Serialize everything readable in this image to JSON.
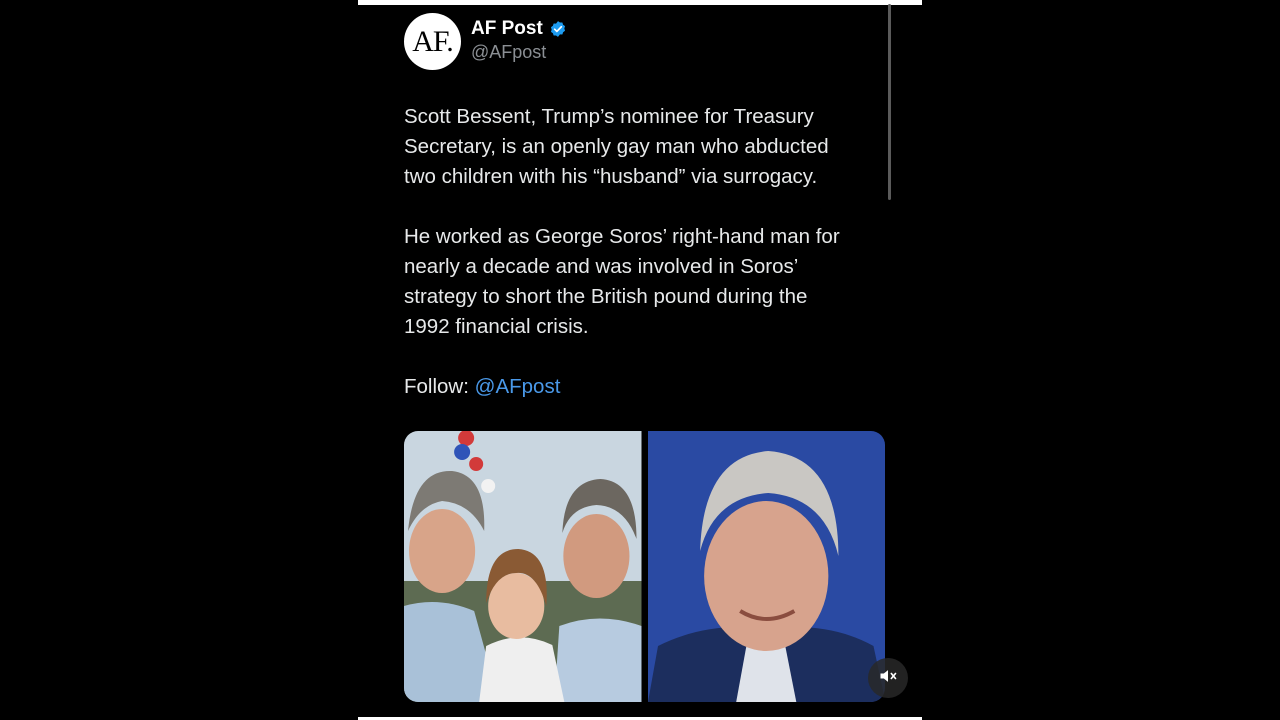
{
  "author": {
    "avatar_text": "AF.",
    "display_name": "AF Post",
    "handle": "@AFpost",
    "verified_icon": "verified-badge-icon"
  },
  "post": {
    "paragraph_1": "Scott Bessent, Trump’s nominee for Treasury\nSecretary, is an openly gay man who abducted\ntwo children with his “husband” via surrogacy.",
    "paragraph_2": "He worked as George Soros’ right-hand man for\nnearly a decade and was involved in Soros’\nstrategy to short the British pound during the\n1992 financial crisis.",
    "follow_label": "Follow: ",
    "follow_mention": "@AFpost"
  },
  "media": {
    "mute_icon": "muted-speaker-icon"
  },
  "colors": {
    "background": "#000000",
    "text": "#e7e9ea",
    "handle": "#8b8f94",
    "link": "#4a99e9",
    "verified": "#1d9bf0"
  }
}
